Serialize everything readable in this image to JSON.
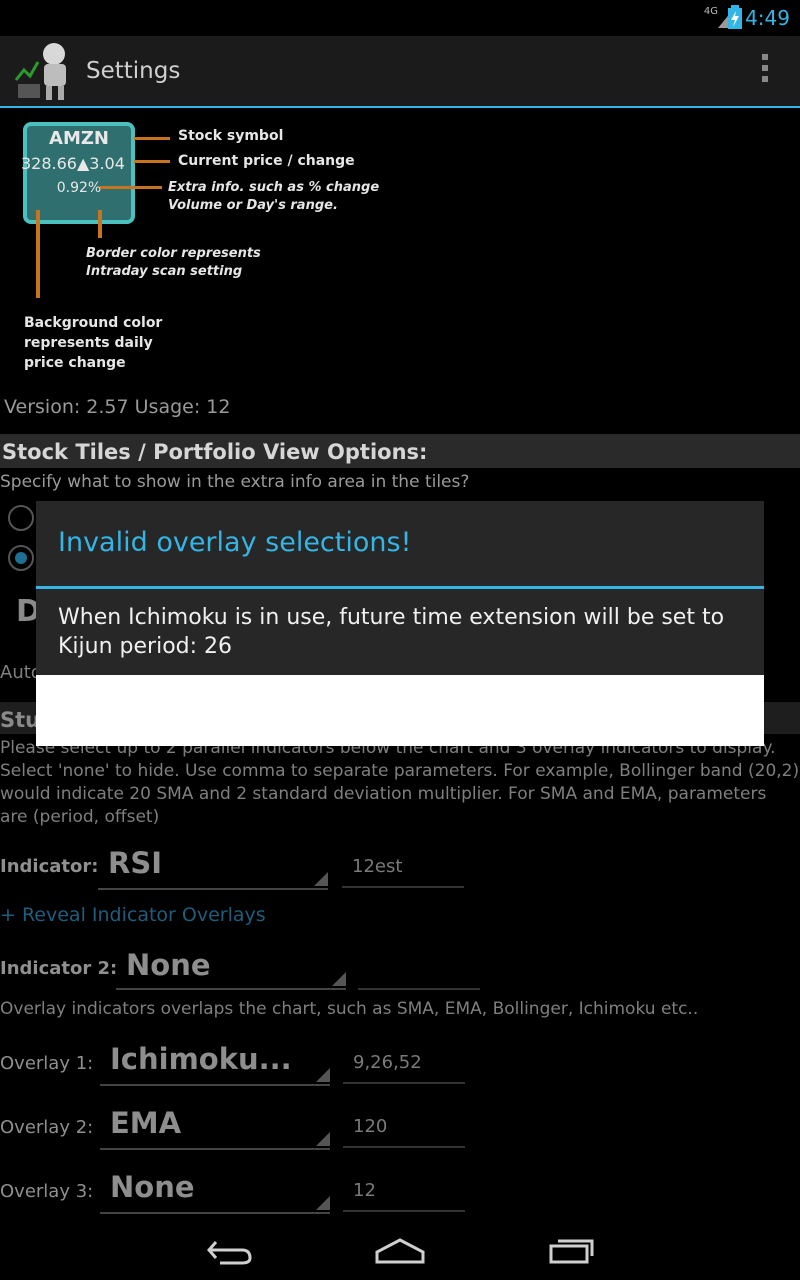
{
  "status_bar": {
    "time": "4:49",
    "network": "4G"
  },
  "action_bar": {
    "title": "Settings",
    "logo_icon": "robot-stock-app-icon",
    "overflow_icon": "overflow-menu-icon"
  },
  "legend": {
    "tile_symbol": "AMZN",
    "tile_price": "328.66▲3.04",
    "tile_extra": "0.92%",
    "stock_symbol": "Stock symbol",
    "current_price": "Current price / change",
    "extra_info_1": "Extra info. such as % change",
    "extra_info_2": "Volume or Day's range.",
    "border_1": "Border color represents",
    "border_2": "Intraday scan setting",
    "background_1": "Background color",
    "background_2": "represents daily",
    "background_3": "price change"
  },
  "version_line": "Version: 2.57  Usage: 12",
  "section": {
    "title": "Stock Tiles / Portfolio View Options:",
    "description": "Specify what to show in the extra info area in the tiles?",
    "partial_d": "D",
    "partial_auto": "Auto",
    "partial_stu": "Stu"
  },
  "study": {
    "desc_1": "Please select up to 2 parallel indicators below the chart and 3 overlay indicators to display.",
    "desc_2": "Select 'none' to hide. Use comma to separate parameters. For example, Bollinger band (20,2)",
    "desc_3": "would indicate 20 SMA and 2 standard deviation multiplier. For SMA and EMA, parameters",
    "desc_4": "are (period, offset)",
    "indicator_label": "Indicator:",
    "indicator_value": "RSI",
    "indicator_param": "12est",
    "reveal_link": "+ Reveal Indicator Overlays",
    "indicator2_label": "Indicator 2:",
    "indicator2_value": "None",
    "indicator2_param": "",
    "overlay_desc": "Overlay indicators overlaps the chart, such as SMA, EMA, Bollinger, Ichimoku etc..",
    "overlay1_label": "Overlay 1:",
    "overlay1_value": "Ichimoku...",
    "overlay1_param": "9,26,52",
    "overlay2_label": "Overlay 2:",
    "overlay2_value": "EMA",
    "overlay2_param": "120",
    "overlay3_label": "Overlay 3:",
    "overlay3_value": "None",
    "overlay3_param": "12"
  },
  "dialog": {
    "title": "Invalid overlay selections!",
    "message": "When Ichimoku is in use, future time extension will be set to Kijun period: 26"
  },
  "nav": {
    "back_icon": "back-icon",
    "home_icon": "home-icon",
    "recents_icon": "recents-icon"
  },
  "colors": {
    "accent": "#33b5e5",
    "legend_arrow": "#c8741f",
    "tile_border": "#4ac0bf"
  }
}
